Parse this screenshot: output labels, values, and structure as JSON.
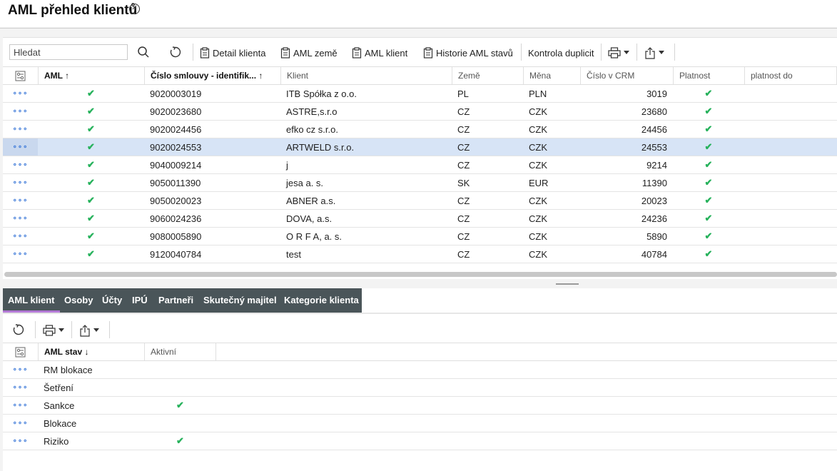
{
  "page": {
    "title": "AML přehled klientů"
  },
  "toolbar": {
    "search_placeholder": "Hledat",
    "buttons": {
      "detail": "Detail klienta",
      "aml_zeme": "AML země",
      "aml_klient": "AML klient",
      "historie": "Historie AML stavů",
      "kontrola": "Kontrola duplicit"
    }
  },
  "grid": {
    "columns": [
      "AML ↑",
      "Číslo smlouvy - identifik...  ↑",
      "Klient",
      "Země",
      "Měna",
      "Číslo v CRM",
      "Platnost",
      "platnost do"
    ],
    "rows": [
      {
        "smlouva": "9020003019",
        "klient": "ITB Spółka z o.o.",
        "zeme": "PL",
        "mena": "PLN",
        "crm": "3019"
      },
      {
        "smlouva": "9020023680",
        "klient": "ASTRE,s.r.o",
        "zeme": "CZ",
        "mena": "CZK",
        "crm": "23680"
      },
      {
        "smlouva": "9020024456",
        "klient": "efko cz s.r.o.",
        "zeme": "CZ",
        "mena": "CZK",
        "crm": "24456"
      },
      {
        "smlouva": "9020024553",
        "klient": "ARTWELD s.r.o.",
        "zeme": "CZ",
        "mena": "CZK",
        "crm": "24553"
      },
      {
        "smlouva": "9040009214",
        "klient": "j",
        "zeme": "CZ",
        "mena": "CZK",
        "crm": "9214"
      },
      {
        "smlouva": "9050011390",
        "klient": "jesa a. s.",
        "zeme": "SK",
        "mena": "EUR",
        "crm": "11390"
      },
      {
        "smlouva": "9050020023",
        "klient": "ABNER a.s.",
        "zeme": "CZ",
        "mena": "CZK",
        "crm": "20023"
      },
      {
        "smlouva": "9060024236",
        "klient": "DOVA, a.s.",
        "zeme": "CZ",
        "mena": "CZK",
        "crm": "24236"
      },
      {
        "smlouva": "9080005890",
        "klient": "O R F A, a. s.",
        "zeme": "CZ",
        "mena": "CZK",
        "crm": "5890"
      },
      {
        "smlouva": "9120040784",
        "klient": "test",
        "zeme": "CZ",
        "mena": "CZK",
        "crm": "40784"
      }
    ],
    "selected_index": 3,
    "row_actions": "∘∘∘",
    "check_mark": "✔"
  },
  "tabs": [
    "AML klient",
    "Osoby",
    "Účty",
    "IPÚ",
    "Partneři",
    "Skutečný majitel",
    "Kategorie klienta"
  ],
  "bottom_grid": {
    "columns": [
      "AML stav ↓",
      "Aktivní"
    ],
    "rows": [
      {
        "stav": "RM blokace",
        "aktivni": false
      },
      {
        "stav": "Šetření",
        "aktivni": false
      },
      {
        "stav": "Sankce",
        "aktivni": true
      },
      {
        "stav": "Blokace",
        "aktivni": false
      },
      {
        "stav": "Riziko",
        "aktivni": true
      }
    ]
  },
  "colors": {
    "tab_bar": "#4a5559",
    "tab_active_underline": "#b37ad6",
    "selected_row": "#d7e4f6",
    "check": "#27b25c",
    "row_action": "#3b78d8"
  }
}
